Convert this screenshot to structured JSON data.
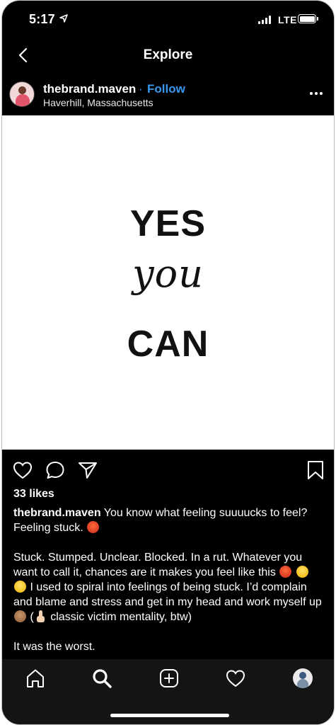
{
  "status_bar": {
    "time": "5:17",
    "network": "LTE"
  },
  "nav": {
    "title": "Explore"
  },
  "post": {
    "username": "thebrand.maven",
    "separator": "·",
    "follow_label": "Follow",
    "location": "Haverhill, Massachusetts",
    "image_text": {
      "line1": "YES",
      "line2": "you",
      "line3": "CAN"
    },
    "likes": "33 likes",
    "caption": {
      "username": "thebrand.maven",
      "p1_text": "You know what feeling suuuucks to feel? Feeling stuck.",
      "p2_a": "Stuck. Stumped. Unclear. Blocked. In a rut. Whatever you want to call it, chances are it makes you feel like this",
      "p2_b": "I used to spiral into feelings of being stuck. I’d complain and blame and stress and get in my head and work myself up",
      "p2_c": "(",
      "p2_d": "classic victim mentality, btw)",
      "p3": "It was the worst."
    }
  },
  "colors": {
    "accent": "#3897f0",
    "background": "#000000",
    "tabbar": "#141414"
  },
  "icons": {
    "back": "chevron-left-icon",
    "more": "more-horizontal-icon",
    "like": "heart-icon",
    "comment": "comment-icon",
    "share": "paper-plane-icon",
    "save": "bookmark-icon",
    "home": "home-icon",
    "search": "search-icon",
    "create": "add-post-icon",
    "activity": "heart-icon",
    "profile": "avatar"
  }
}
